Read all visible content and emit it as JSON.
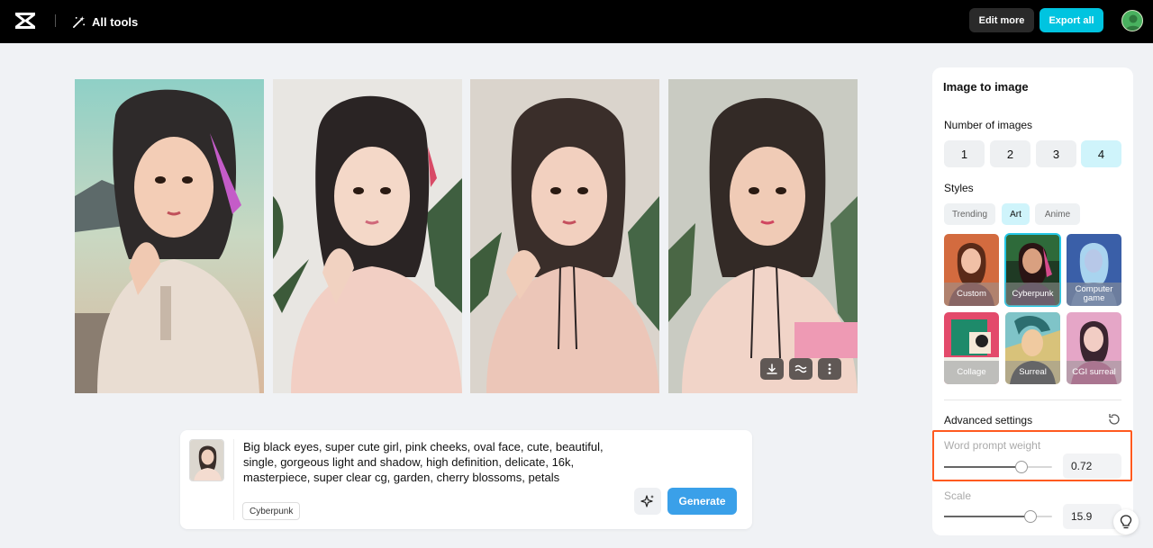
{
  "topbar": {
    "logo_icon": "capcut-logo-icon",
    "all_tools_label": "All tools",
    "all_tools_icon": "magic-wand-icon",
    "edit_more_label": "Edit more",
    "export_all_label": "Export all",
    "accent_color": "#00c4e0"
  },
  "gallery": {
    "images": [
      {
        "description": "generated-image-1"
      },
      {
        "description": "generated-image-2"
      },
      {
        "description": "generated-image-3"
      },
      {
        "description": "generated-image-4"
      }
    ],
    "actions": [
      "download-icon",
      "variation-icon",
      "more-vertical-icon"
    ]
  },
  "prompt": {
    "text": "Big black eyes, super cute girl, pink cheeks, oval face, cute, beautiful, single, gorgeous light and shadow, high definition, delicate, 16k, masterpiece, super clear cg, garden, cherry blossoms, petals",
    "style_tag": "Cyberpunk",
    "generate_label": "Generate",
    "magic_icon": "sparkle-icon"
  },
  "panel": {
    "title": "Image to image",
    "number_of_images_label": "Number of images",
    "number_options": [
      "1",
      "2",
      "3",
      "4"
    ],
    "selected_number": "4",
    "styles_label": "Styles",
    "style_tabs": [
      "Trending",
      "Art",
      "Anime"
    ],
    "selected_tab": "Art",
    "style_cards": [
      "Custom",
      "Cyberpunk",
      "Computer game",
      "Collage",
      "Surreal",
      "CGI surreal"
    ],
    "selected_style": "Cyberpunk",
    "advanced_settings_label": "Advanced settings",
    "word_prompt_weight_label": "Word prompt weight",
    "word_prompt_weight_value": "0.72",
    "word_prompt_weight_fraction": 0.72,
    "scale_label": "Scale",
    "scale_value": "15.9",
    "scale_fraction": 0.8
  },
  "colors": {
    "highlight": "#ff5a1f",
    "selected_bg": "#cff4fb",
    "generate": "#3aa0e9"
  }
}
